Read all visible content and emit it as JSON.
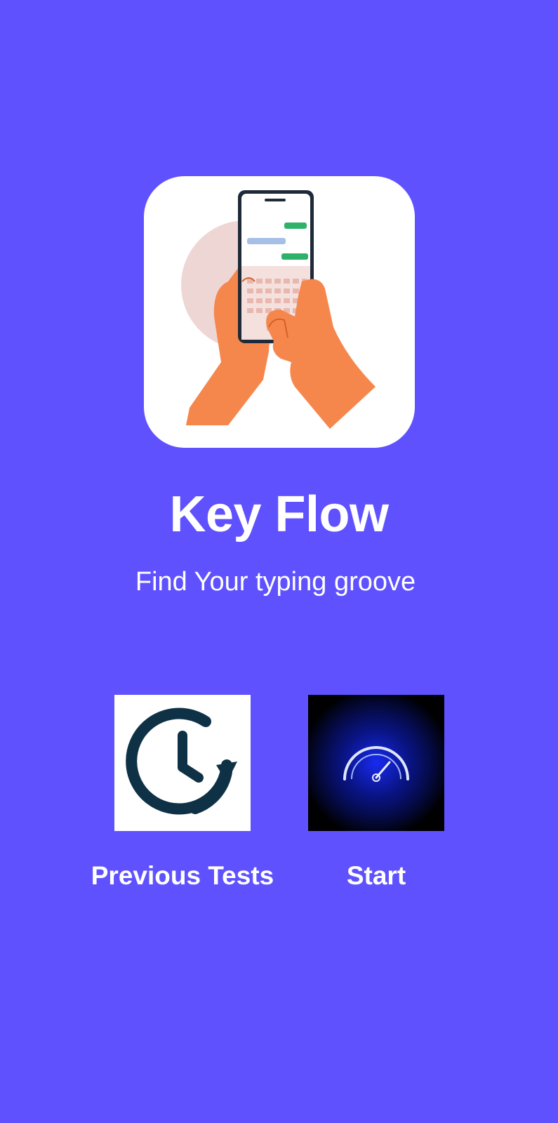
{
  "app": {
    "title": "Key Flow",
    "tagline": "Find Your typing groove"
  },
  "actions": [
    {
      "id": "previous-tests",
      "label": "Previous Tests",
      "icon": "history-clock-icon"
    },
    {
      "id": "start",
      "label": "Start",
      "icon": "speedometer-icon"
    }
  ],
  "colors": {
    "background": "#5F52FE",
    "text": "#FFFFFF",
    "logo_card": "#FFFFFF",
    "history_icon": "#0F3146",
    "speedometer_glow": "#1A2DFF"
  }
}
